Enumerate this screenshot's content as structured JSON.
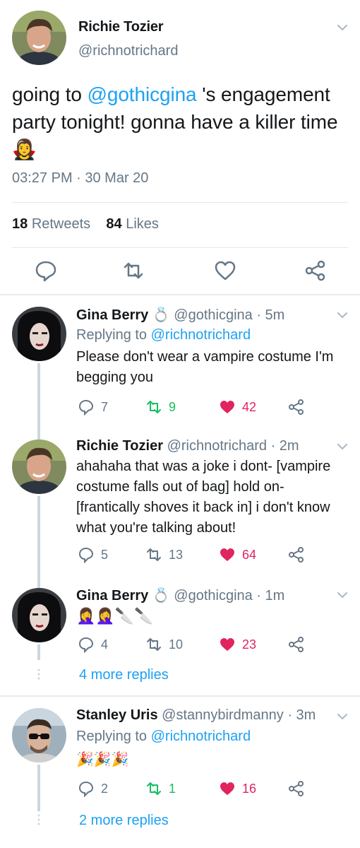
{
  "main_tweet": {
    "name": "Richie Tozier",
    "handle": "@richnotrichard",
    "text_before": "going to ",
    "mention": "@gothicgina",
    "text_after": " 's engagement party tonight! gonna have a killer time ",
    "emoji": "🧛‍♀️",
    "timestamp": "03:27 PM · 30 Mar 20",
    "retweets_count": "18",
    "retweets_label": "Retweets",
    "likes_count": "84",
    "likes_label": "Likes"
  },
  "replies": [
    {
      "name": "Gina Berry",
      "name_emoji": "💍",
      "handle": "@gothicgina",
      "time": "· 5m",
      "replying_label": "Replying to",
      "replying_to": "@richnotrichard",
      "text": "Please don't wear a vampire costume I'm begging you",
      "replies": "7",
      "retweets": "9",
      "likes": "42"
    },
    {
      "name": "Richie Tozier",
      "handle": "@richnotrichard",
      "time": "· 2m",
      "text": "ahahaha that was a joke i dont- [vampire costume falls out of bag] hold on- [frantically shoves it back in] i don't know what you're talking about!",
      "replies": "5",
      "retweets": "13",
      "likes": "64"
    },
    {
      "name": "Gina Berry",
      "name_emoji": "💍",
      "handle": "@gothicgina",
      "time": "· 1m",
      "text": "🤦‍♀️🤦‍♀️🔪🔪",
      "replies": "4",
      "retweets": "10",
      "likes": "23",
      "more_replies": "4 more replies"
    },
    {
      "name": "Stanley Uris",
      "handle": "@stannybirdmanny",
      "time": "· 3m",
      "replying_label": "Replying to",
      "replying_to": "@richnotrichard",
      "text": "🎉🎉🎉",
      "replies": "2",
      "retweets": "1",
      "likes": "16",
      "more_replies": "2 more replies"
    }
  ],
  "colors": {
    "link": "#1da1f2",
    "muted": "#657786",
    "retweet_green": "#17bf63",
    "like_red": "#e0245e",
    "divider": "#e1e8ed"
  },
  "icons": {
    "reply": "speech-bubble-icon",
    "retweet": "retweet-arrows-icon",
    "like": "heart-icon",
    "share": "share-nodes-icon",
    "menu": "chevron-down-icon"
  }
}
